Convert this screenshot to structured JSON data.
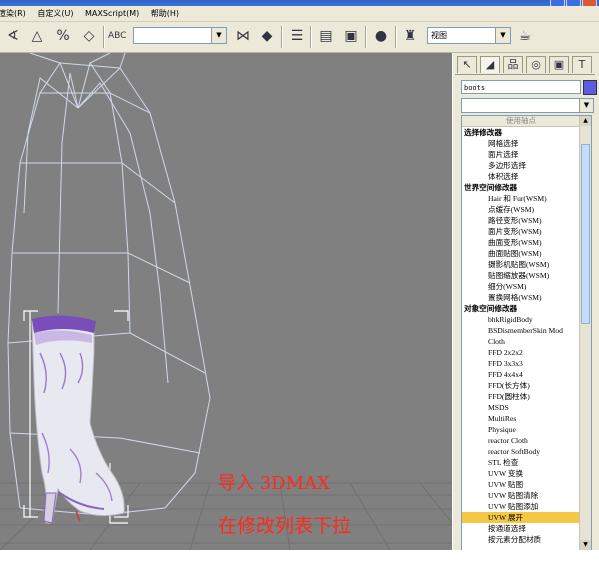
{
  "menubar": {
    "items": [
      "渲染(R)",
      "自定义(U)",
      "MAXScript(M)",
      "帮助(H)"
    ]
  },
  "toolbar": {
    "view_combo": "视图",
    "selection_combo": ""
  },
  "command_panel": {
    "object_name": "boots",
    "color": "#5c5ce0",
    "modifier_list": [
      {
        "label": "使用轴点",
        "type": "hdr"
      },
      {
        "label": "选择修改器",
        "type": "cat"
      },
      {
        "label": "网格选择",
        "type": "item"
      },
      {
        "label": "面片选择",
        "type": "item"
      },
      {
        "label": "多边形选择",
        "type": "item"
      },
      {
        "label": "体积选择",
        "type": "item"
      },
      {
        "label": "世界空间修改器",
        "type": "cat"
      },
      {
        "label": "Hair 和 Fur(WSM)",
        "type": "item"
      },
      {
        "label": "点缓存(WSM)",
        "type": "item"
      },
      {
        "label": "路径变形(WSM)",
        "type": "item"
      },
      {
        "label": "面片变形(WSM)",
        "type": "item"
      },
      {
        "label": "曲面变形(WSM)",
        "type": "item"
      },
      {
        "label": "曲面贴图(WSM)",
        "type": "item"
      },
      {
        "label": "摄影机贴图(WSM)",
        "type": "item"
      },
      {
        "label": "贴图缩放器(WSM)",
        "type": "item"
      },
      {
        "label": "细分(WSM)",
        "type": "item"
      },
      {
        "label": "置换网格(WSM)",
        "type": "item"
      },
      {
        "label": "对象空间修改器",
        "type": "cat"
      },
      {
        "label": "bhkRigidBody",
        "type": "item"
      },
      {
        "label": "BSDismemberSkin Mod",
        "type": "item"
      },
      {
        "label": "Cloth",
        "type": "item"
      },
      {
        "label": "FFD 2x2x2",
        "type": "item"
      },
      {
        "label": "FFD 3x3x3",
        "type": "item"
      },
      {
        "label": "FFD 4x4x4",
        "type": "item"
      },
      {
        "label": "FFD(长方体)",
        "type": "item"
      },
      {
        "label": "FFD(圆柱体)",
        "type": "item"
      },
      {
        "label": "MSDS",
        "type": "item"
      },
      {
        "label": "MultiRes",
        "type": "item"
      },
      {
        "label": "Physique",
        "type": "item"
      },
      {
        "label": "reactor Cloth",
        "type": "item"
      },
      {
        "label": "reactor SoftBody",
        "type": "item"
      },
      {
        "label": "STL 检查",
        "type": "item"
      },
      {
        "label": "UVW 变换",
        "type": "item"
      },
      {
        "label": "UVW 贴图",
        "type": "item"
      },
      {
        "label": "UVW 贴图清除",
        "type": "item"
      },
      {
        "label": "UVW 贴图添加",
        "type": "item"
      },
      {
        "label": "UVW 展开",
        "type": "item",
        "selected": true
      },
      {
        "label": "按通道选择",
        "type": "item"
      },
      {
        "label": "按元素分配材质",
        "type": "item"
      }
    ]
  },
  "viewport": {
    "annotation_1": "导入 3DMAX",
    "annotation_2": "在修改列表下拉",
    "annotation_color": "#ff2a1a"
  }
}
